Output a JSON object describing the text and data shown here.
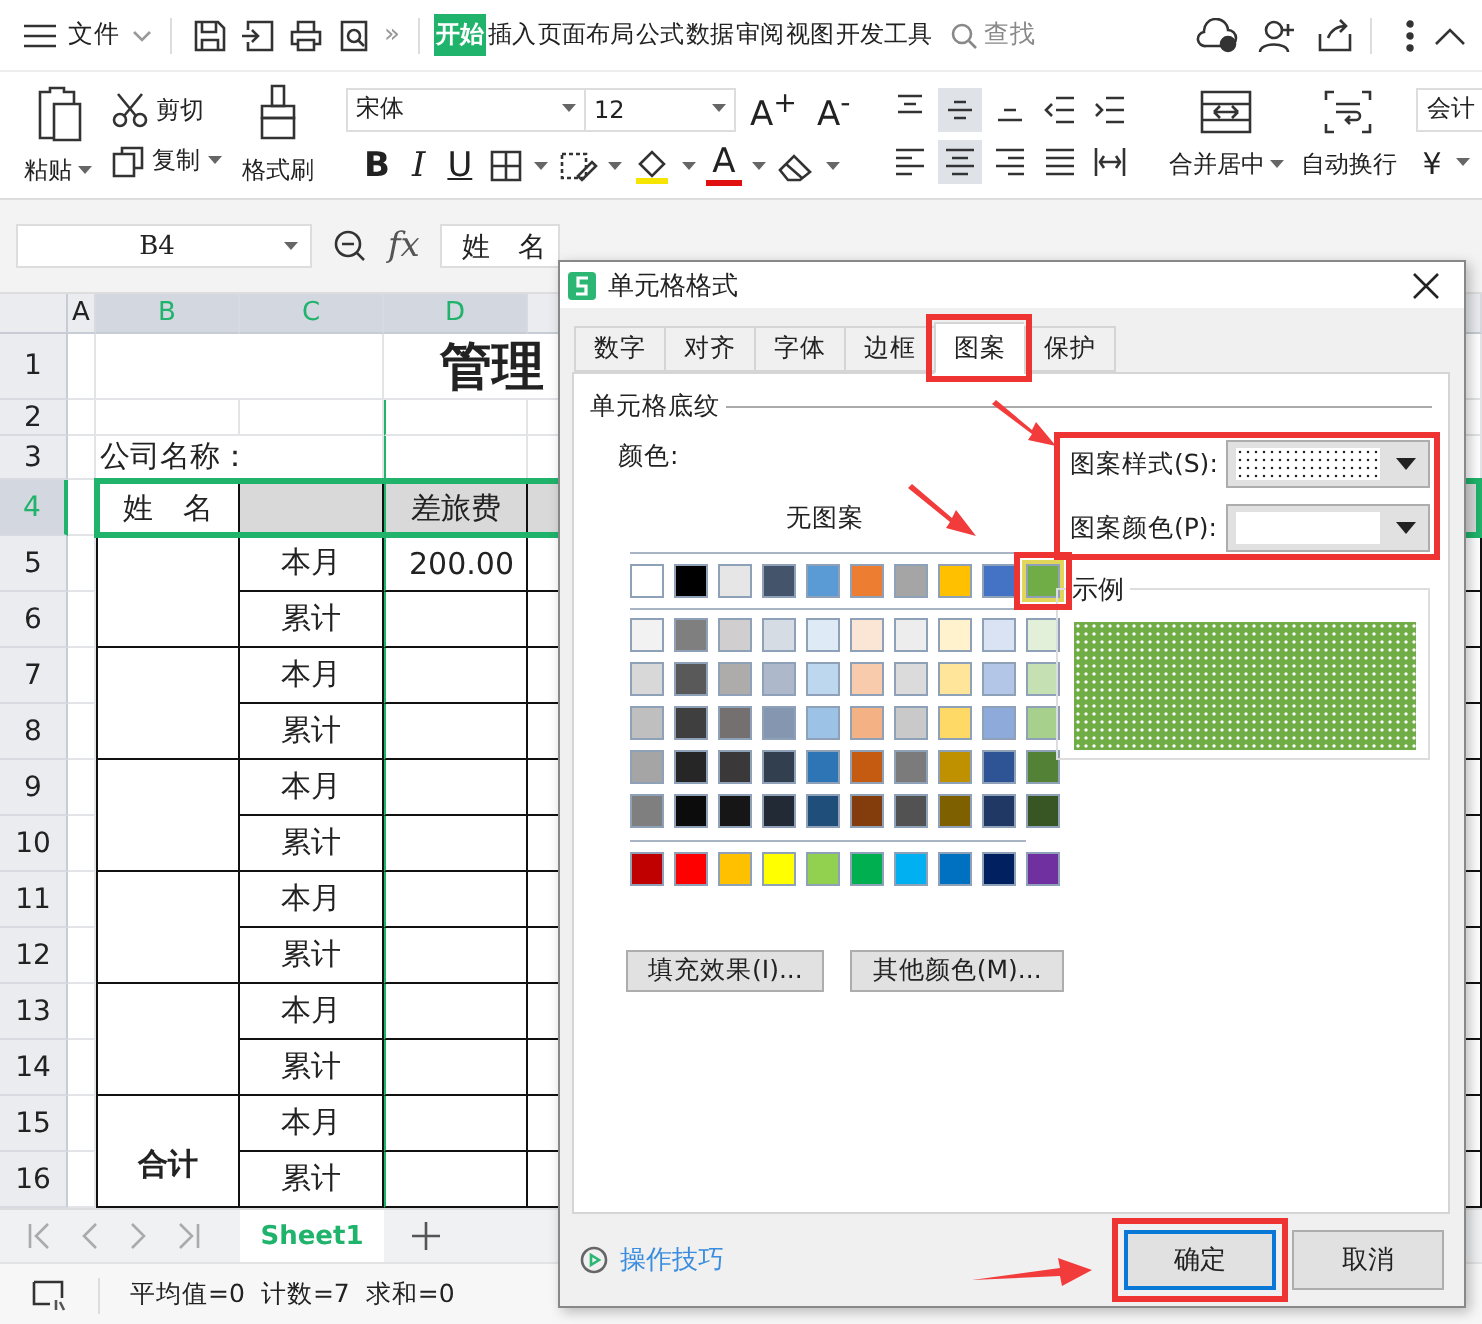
{
  "menu_bar": {
    "file_menu": "文件",
    "more": "»",
    "tabs": [
      {
        "label": "开始",
        "selected": true
      },
      {
        "label": "插入",
        "selected": false
      },
      {
        "label": "页面布局",
        "selected": false
      },
      {
        "label": "公式",
        "selected": false
      },
      {
        "label": "数据",
        "selected": false
      },
      {
        "label": "审阅",
        "selected": false
      },
      {
        "label": "视图",
        "selected": false
      },
      {
        "label": "开发工具",
        "selected": false
      }
    ],
    "search": "查找"
  },
  "ribbon": {
    "paste": "粘贴",
    "cut": "剪切",
    "copy": "复制",
    "format_painter": "格式刷",
    "font": "宋体",
    "font_size": "12",
    "grow_font": "A$^{+}$",
    "shrink_font": "A$^{-}$",
    "bold": "B",
    "italic": "I",
    "underline": "U",
    "font_color": "A",
    "align_buttons": [
      {
        "kind": "top",
        "selected": false
      },
      {
        "kind": "middle",
        "selected": true
      },
      {
        "kind": "bottom",
        "selected": false
      },
      {
        "kind": "outdent",
        "selected": false
      },
      {
        "kind": "indent",
        "selected": false
      },
      {
        "kind": "left",
        "selected": false
      },
      {
        "kind": "center",
        "selected": true
      },
      {
        "kind": "right",
        "selected": false
      },
      {
        "kind": "justify",
        "selected": false
      },
      {
        "kind": "distributed",
        "selected": false
      }
    ],
    "merge": "合并居中",
    "wrap": "自动换行",
    "number_format": "会计",
    "currency": "¥"
  },
  "formula_bar": {
    "cell_ref": "B4",
    "fx": "fx",
    "content": "姓　名"
  },
  "sheet": {
    "columns": [
      {
        "label": "A",
        "selected": false
      },
      {
        "label": "B",
        "selected": true
      },
      {
        "label": "C",
        "selected": true
      },
      {
        "label": "D",
        "selected": true
      }
    ],
    "title": "管理",
    "company_label": "公司名称：",
    "header": {
      "name": "姓　名",
      "column_d": "差旅费"
    },
    "groups": [
      {
        "rows": [
          {
            "period": "本月",
            "amount": "200.00"
          },
          {
            "period": "累计"
          }
        ]
      },
      {
        "rows": [
          {
            "period": "本月"
          },
          {
            "period": "累计"
          }
        ]
      },
      {
        "rows": [
          {
            "period": "本月"
          },
          {
            "period": "累计"
          }
        ]
      },
      {
        "rows": [
          {
            "period": "本月"
          },
          {
            "period": "累计"
          }
        ]
      },
      {
        "rows": [
          {
            "period": "本月"
          },
          {
            "period": "累计"
          }
        ]
      },
      {
        "name": "合计",
        "rows": [
          {
            "period": "本月"
          },
          {
            "period": "累计"
          }
        ]
      }
    ],
    "row_numbers": [
      {
        "label": "1",
        "selected": false
      },
      {
        "label": "2",
        "selected": false
      },
      {
        "label": "3",
        "selected": false
      },
      {
        "label": "4",
        "selected": true
      },
      {
        "label": "5",
        "selected": false
      },
      {
        "label": "6",
        "selected": false
      },
      {
        "label": "7",
        "selected": false
      },
      {
        "label": "8",
        "selected": false
      },
      {
        "label": "9",
        "selected": false
      },
      {
        "label": "10",
        "selected": false
      },
      {
        "label": "11",
        "selected": false
      },
      {
        "label": "12",
        "selected": false
      },
      {
        "label": "13",
        "selected": false
      },
      {
        "label": "14",
        "selected": false
      },
      {
        "label": "15",
        "selected": false
      },
      {
        "label": "16",
        "selected": false
      }
    ]
  },
  "sheet_tabs": [
    {
      "label": "Sheet1",
      "selected": true
    }
  ],
  "status_bar": [
    "平均值=0",
    "计数=7",
    "求和=0"
  ],
  "dialog": {
    "title": "单元格格式",
    "tabs": [
      {
        "label": "数字",
        "selected": false
      },
      {
        "label": "对齐",
        "selected": false
      },
      {
        "label": "字体",
        "selected": false
      },
      {
        "label": "边框",
        "selected": false
      },
      {
        "label": "图案",
        "selected": true
      },
      {
        "label": "保护",
        "selected": false
      }
    ],
    "section": "单元格底纹",
    "color_label": "颜色:",
    "no_pattern": "无图案",
    "theme_colors": [
      [
        {
          "color": "#ffffff",
          "selected": false
        },
        {
          "color": "#000000",
          "selected": false
        },
        {
          "color": "#e7e6e6",
          "selected": false
        },
        {
          "color": "#44546a",
          "selected": false
        },
        {
          "color": "#5b9bd5",
          "selected": false
        },
        {
          "color": "#ed7d31",
          "selected": false
        },
        {
          "color": "#a5a5a5",
          "selected": false
        },
        {
          "color": "#ffc000",
          "selected": false
        },
        {
          "color": "#4472c4",
          "selected": false
        },
        {
          "color": "#70ad47",
          "selected": true
        }
      ],
      [
        {
          "color": "#f2f2f2",
          "selected": false
        },
        {
          "color": "#7f7f7f",
          "selected": false
        },
        {
          "color": "#d0cece",
          "selected": false
        },
        {
          "color": "#d6dce4",
          "selected": false
        },
        {
          "color": "#deebf6",
          "selected": false
        },
        {
          "color": "#fbe5d5",
          "selected": false
        },
        {
          "color": "#ededed",
          "selected": false
        },
        {
          "color": "#fff2cc",
          "selected": false
        },
        {
          "color": "#dae3f3",
          "selected": false
        },
        {
          "color": "#e2efd9",
          "selected": false
        }
      ],
      [
        {
          "color": "#d8d8d8",
          "selected": false
        },
        {
          "color": "#595959",
          "selected": false
        },
        {
          "color": "#aeabab",
          "selected": false
        },
        {
          "color": "#adb9ca",
          "selected": false
        },
        {
          "color": "#bdd7ee",
          "selected": false
        },
        {
          "color": "#f7cbac",
          "selected": false
        },
        {
          "color": "#dbdbdb",
          "selected": false
        },
        {
          "color": "#fee599",
          "selected": false
        },
        {
          "color": "#b4c6e7",
          "selected": false
        },
        {
          "color": "#c5e0b3",
          "selected": false
        }
      ],
      [
        {
          "color": "#bfbfbf",
          "selected": false
        },
        {
          "color": "#3f3f3f",
          "selected": false
        },
        {
          "color": "#757070",
          "selected": false
        },
        {
          "color": "#8496b0",
          "selected": false
        },
        {
          "color": "#9cc3e5",
          "selected": false
        },
        {
          "color": "#f4b183",
          "selected": false
        },
        {
          "color": "#c9c9c9",
          "selected": false
        },
        {
          "color": "#ffd965",
          "selected": false
        },
        {
          "color": "#8eaadb",
          "selected": false
        },
        {
          "color": "#a8d08d",
          "selected": false
        }
      ],
      [
        {
          "color": "#a5a5a5",
          "selected": false
        },
        {
          "color": "#262626",
          "selected": false
        },
        {
          "color": "#3a3838",
          "selected": false
        },
        {
          "color": "#323f4f",
          "selected": false
        },
        {
          "color": "#2e75b5",
          "selected": false
        },
        {
          "color": "#c55a11",
          "selected": false
        },
        {
          "color": "#7b7b7b",
          "selected": false
        },
        {
          "color": "#bf9000",
          "selected": false
        },
        {
          "color": "#2f5496",
          "selected": false
        },
        {
          "color": "#538135",
          "selected": false
        }
      ],
      [
        {
          "color": "#7f7f7f",
          "selected": false
        },
        {
          "color": "#0c0c0c",
          "selected": false
        },
        {
          "color": "#171616",
          "selected": false
        },
        {
          "color": "#222a35",
          "selected": false
        },
        {
          "color": "#1e4e79",
          "selected": false
        },
        {
          "color": "#833c0b",
          "selected": false
        },
        {
          "color": "#525252",
          "selected": false
        },
        {
          "color": "#7f6000",
          "selected": false
        },
        {
          "color": "#1f3864",
          "selected": false
        },
        {
          "color": "#375623",
          "selected": false
        }
      ]
    ],
    "standard_colors": [
      {
        "color": "#c00000",
        "selected": false
      },
      {
        "color": "#ff0000",
        "selected": false
      },
      {
        "color": "#ffc000",
        "selected": false
      },
      {
        "color": "#ffff00",
        "selected": false
      },
      {
        "color": "#92d050",
        "selected": false
      },
      {
        "color": "#00b050",
        "selected": false
      },
      {
        "color": "#00b0f0",
        "selected": false
      },
      {
        "color": "#0070c0",
        "selected": false
      },
      {
        "color": "#002060",
        "selected": false
      },
      {
        "color": "#7030a0",
        "selected": false
      }
    ],
    "fill_effects_button": "填充效果(I)...",
    "more_colors_button": "其他颜色(M)...",
    "pattern_style_label": "图案样式(S):",
    "pattern_style": {
      "kind": "dots"
    },
    "pattern_color_label": "图案颜色(P):",
    "sample_label": "示例",
    "tips_link": "操作技巧",
    "ok_button": "确定",
    "cancel_button": "取消"
  }
}
